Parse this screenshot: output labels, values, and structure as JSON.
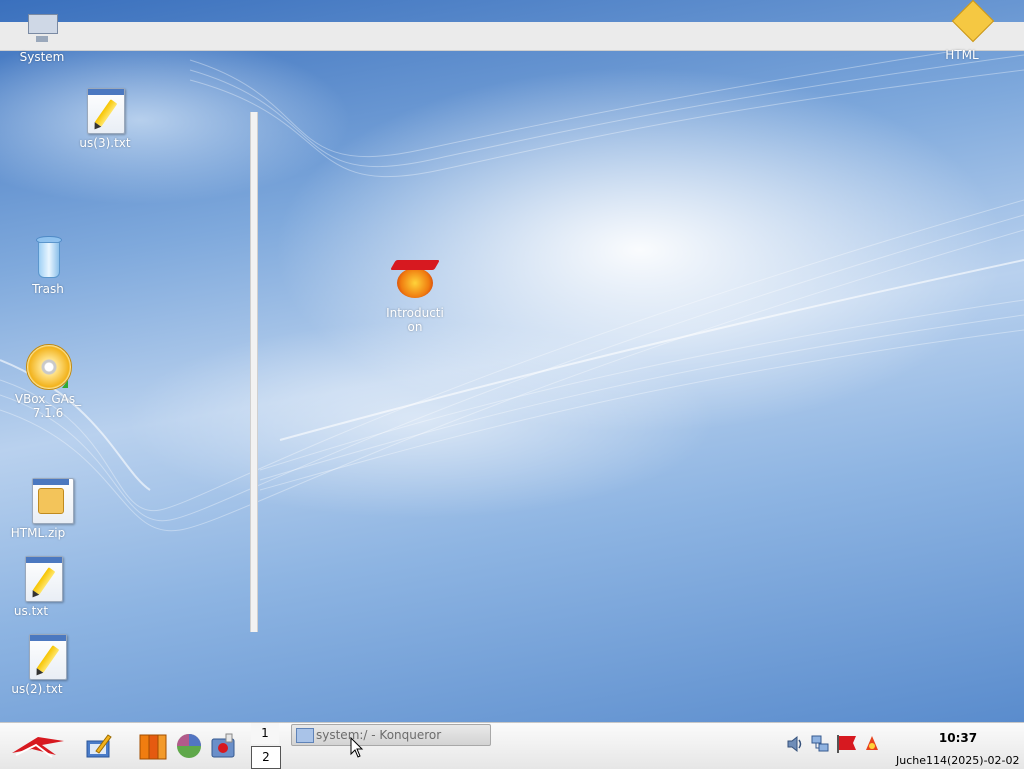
{
  "desktop": {
    "icons": [
      {
        "name": "System",
        "type": "computer"
      },
      {
        "name": "us(3).txt",
        "type": "text"
      },
      {
        "name": "Trash",
        "type": "trash"
      },
      {
        "name": "VBox_GAs_7.1.6",
        "label_line1": "VBox_GAs_",
        "label_line2": "7.1.6",
        "type": "cdrom"
      },
      {
        "name": "HTML.zip",
        "type": "zip"
      },
      {
        "name": "us.txt",
        "type": "text"
      },
      {
        "name": "us(2).txt",
        "type": "text"
      },
      {
        "name": "HTML",
        "type": "folder"
      },
      {
        "name": "Introduction",
        "label_line1": "Introducti",
        "label_line2": "on",
        "type": "app"
      }
    ]
  },
  "taskbar": {
    "launchers": [
      "start-menu-icon",
      "editor-icon",
      "office-icon",
      "browser-globe-icon",
      "settings-icon"
    ],
    "pager": {
      "desktops": [
        "1",
        "2"
      ],
      "active": "2"
    },
    "tasks": [
      {
        "label": "system:/ - Konqueror",
        "icon": "konqueror-icon"
      }
    ],
    "tray": [
      "speaker-icon",
      "network-icon",
      "flag-icon",
      "notification-icon"
    ],
    "clock": "10:37",
    "date": "Juche114(2025)-02-02"
  },
  "colors": {
    "wallpaper_primary": "#3a70bd",
    "wallpaper_highlight": "#ffffff",
    "taskbar_bg": "#ebebeb",
    "accent_red": "#d71920"
  }
}
